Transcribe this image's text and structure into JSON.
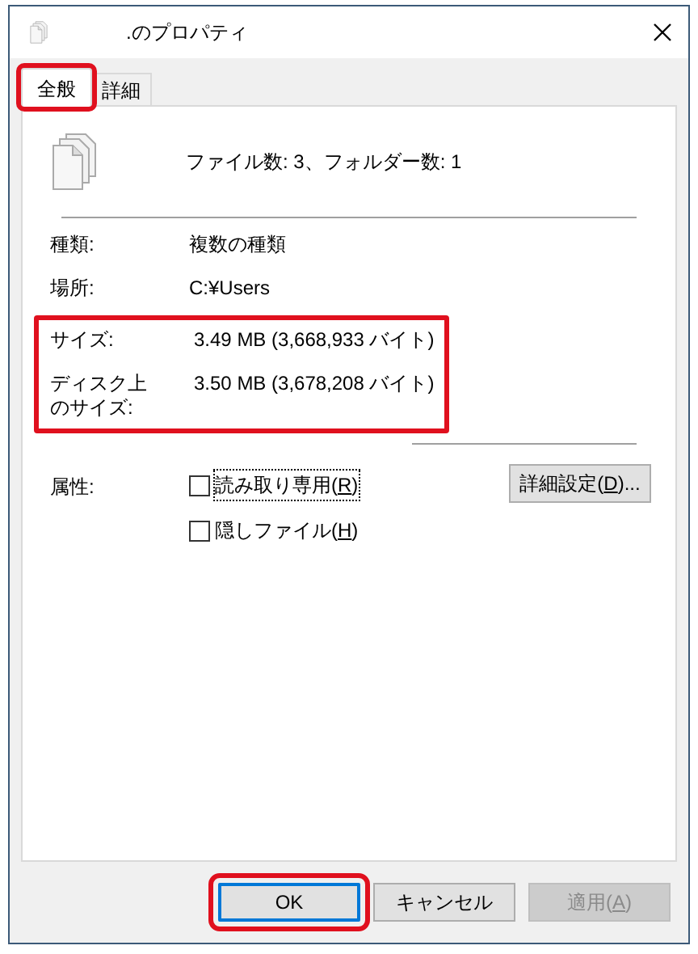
{
  "window": {
    "title": ".のプロパティ"
  },
  "tabs": [
    {
      "label": "全般",
      "selected": true,
      "highlighted": true
    },
    {
      "label": "詳細",
      "selected": false,
      "highlighted": false
    }
  ],
  "summary": "ファイル数: 3、フォルダー数: 1",
  "groups": [
    {
      "highlighted": false,
      "rows": [
        {
          "label": "種類:",
          "value": "複数の種類"
        },
        {
          "label": "場所:",
          "value": "C:¥Users"
        }
      ]
    },
    {
      "highlighted": true,
      "rows": [
        {
          "label": "サイズ:",
          "value": "3.49 MB (3,668,933 バイト)"
        },
        {
          "label": "ディスク上のサイズ:",
          "value": "3.50 MB (3,678,208 バイト)"
        }
      ]
    }
  ],
  "attributes": {
    "label": "属性:",
    "options": [
      {
        "before": "読み取り専用(",
        "key": "R",
        "after": ")",
        "checked": false,
        "focused": true
      },
      {
        "before": "隠しファイル(",
        "key": "H",
        "after": ")",
        "checked": false,
        "focused": false
      }
    ],
    "advanced_button": {
      "before": "詳細設定(",
      "key": "D",
      "after": ")..."
    }
  },
  "buttons": [
    {
      "before": "OK",
      "default": true,
      "disabled": false,
      "highlighted": true
    },
    {
      "before": "キャンセル",
      "default": false,
      "disabled": false,
      "highlighted": false
    },
    {
      "before": "適用(",
      "key": "A",
      "after": ")",
      "default": false,
      "disabled": true,
      "highlighted": false
    }
  ]
}
